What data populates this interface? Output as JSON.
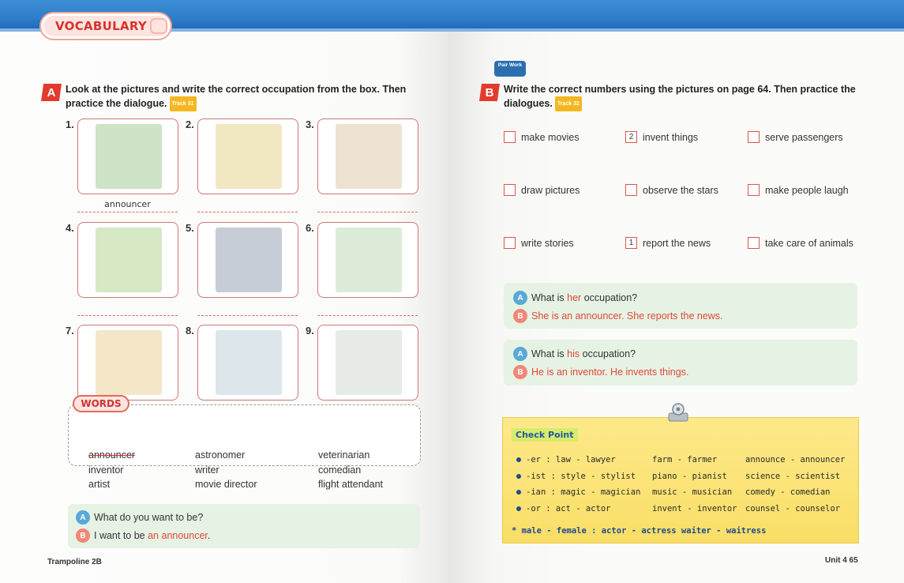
{
  "vocabulary_title": "VOCABULARY",
  "section_a": {
    "badge": "A",
    "instruction_line1": "Look at the pictures and write the correct occupation from the box. Then",
    "instruction_line2": "practice the dialogue.",
    "track": "Track 31",
    "cards": [
      {
        "num": "1.",
        "answer": "announcer",
        "color": "#cfe3c6"
      },
      {
        "num": "2.",
        "answer": "",
        "color": "#f1e7c3"
      },
      {
        "num": "3.",
        "answer": "",
        "color": "#eee2d2"
      },
      {
        "num": "4.",
        "answer": "",
        "color": "#d6e8c4"
      },
      {
        "num": "5.",
        "answer": "",
        "color": "#c7cdd6"
      },
      {
        "num": "6.",
        "answer": "",
        "color": "#dcecd8"
      },
      {
        "num": "7.",
        "answer": "",
        "color": "#f3e7c8"
      },
      {
        "num": "8.",
        "answer": "",
        "color": "#dde6ea"
      },
      {
        "num": "9.",
        "answer": "",
        "color": "#e6ebe8"
      }
    ]
  },
  "words": {
    "tag": "WORDS",
    "list": [
      [
        "announcer",
        "astronomer",
        "veterinarian"
      ],
      [
        "inventor",
        "writer",
        "comedian"
      ],
      [
        "artist",
        "movie director",
        "flight attendant"
      ]
    ]
  },
  "dialogue_a": {
    "q": "What do you want to be?",
    "a_prefix": "I want to be ",
    "a_highlight": "an announcer",
    "a_suffix": "."
  },
  "pair_work": "Pair Work",
  "section_b": {
    "badge": "B",
    "instruction_line1": "Write the correct numbers using the pictures on page 64. Then practice the",
    "instruction_line2": "dialogues.",
    "track": "Track 32",
    "items": [
      {
        "label": "make movies",
        "value": ""
      },
      {
        "label": "invent things",
        "value": "2"
      },
      {
        "label": "serve passengers",
        "value": ""
      },
      {
        "label": "draw pictures",
        "value": ""
      },
      {
        "label": "observe the stars",
        "value": ""
      },
      {
        "label": "make people laugh",
        "value": ""
      },
      {
        "label": "write stories",
        "value": ""
      },
      {
        "label": "report the news",
        "value": "1"
      },
      {
        "label": "take care of animals",
        "value": ""
      }
    ]
  },
  "dialogue_b1": {
    "q_prefix": "What is ",
    "q_highlight": "her",
    "q_suffix": " occupation?",
    "a": "She is an announcer. She reports the news."
  },
  "dialogue_b2": {
    "q_prefix": "What is ",
    "q_highlight": "his",
    "q_suffix": " occupation?",
    "a": "He is an inventor. He invents things."
  },
  "check_point": {
    "title": "Check Point",
    "rows": [
      {
        "suffix": "-er  :  law - lawyer",
        "c2": "farm - farmer",
        "c3": "announce - announcer"
      },
      {
        "suffix": "-ist :  style - stylist",
        "c2": "piano - pianist",
        "c3": "science - scientist"
      },
      {
        "suffix": "-ian :  magic - magician",
        "c2": "music - musician",
        "c3": "comedy - comedian"
      },
      {
        "suffix": "-or  :  act - actor",
        "c2": "invent - inventor",
        "c3": "counsel - counselor"
      }
    ],
    "note": "* male - female :  actor - actress     waiter - waitress"
  },
  "footer_left": "Trampoline 2B",
  "footer_right": "Unit 4  65",
  "colors": {
    "accent_red": "#e23b2e",
    "dialogue_bg": "#e6f3e4",
    "checkpoint_bg": "#fbe47a"
  }
}
